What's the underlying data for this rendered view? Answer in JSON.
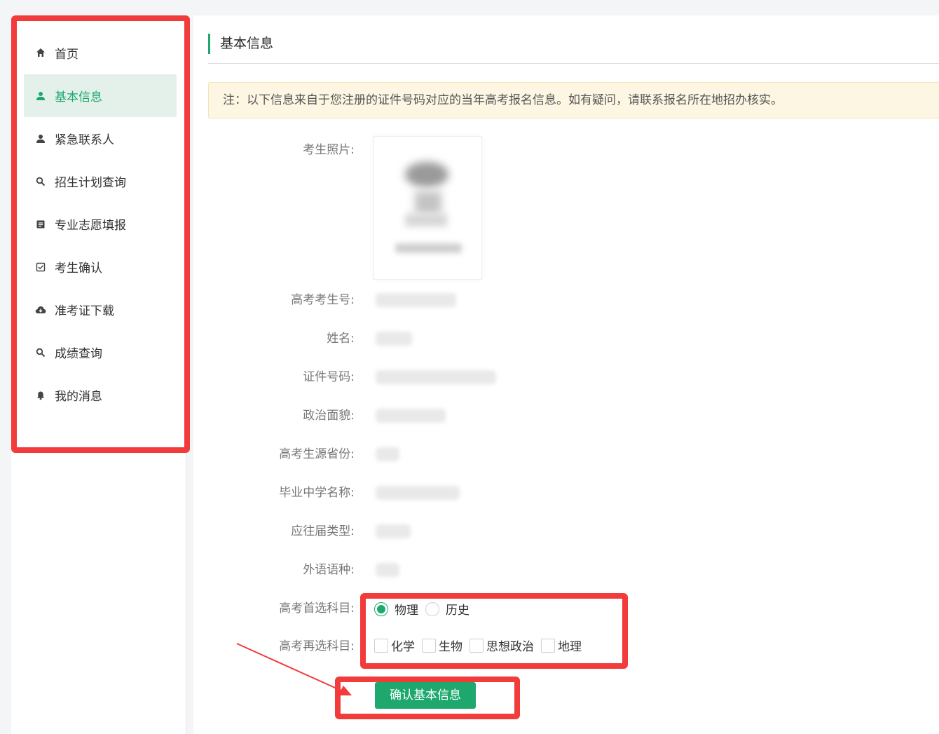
{
  "sidebar": {
    "items": [
      {
        "label": "首页",
        "icon": "home-icon"
      },
      {
        "label": "基本信息",
        "icon": "person-icon",
        "active": true
      },
      {
        "label": "紧急联系人",
        "icon": "person-icon"
      },
      {
        "label": "招生计划查询",
        "icon": "search-icon"
      },
      {
        "label": "专业志愿填报",
        "icon": "document-icon"
      },
      {
        "label": "考生确认",
        "icon": "checkbox-icon"
      },
      {
        "label": "准考证下载",
        "icon": "cloud-download-icon"
      },
      {
        "label": "成绩查询",
        "icon": "search-icon"
      },
      {
        "label": "我的消息",
        "icon": "bell-icon"
      }
    ]
  },
  "main": {
    "title": "基本信息",
    "notice": "注：以下信息来自于您注册的证件号码对应的当年高考报名信息。如有疑问，请联系报名所在地招办核实。",
    "photo_label": "考生照片:",
    "fields": [
      {
        "label": "高考考生号:"
      },
      {
        "label": "姓名:"
      },
      {
        "label": "证件号码:"
      },
      {
        "label": "政治面貌:"
      },
      {
        "label": "高考生源省份:"
      },
      {
        "label": "毕业中学名称:"
      },
      {
        "label": "应往届类型:"
      },
      {
        "label": "外语语种:"
      }
    ],
    "first_subject": {
      "label": "高考首选科目:",
      "options": [
        "物理",
        "历史"
      ],
      "selected": "物理"
    },
    "second_subject": {
      "label": "高考再选科目:",
      "options": [
        "化学",
        "生物",
        "思想政治",
        "地理"
      ]
    },
    "confirm_button": "确认基本信息"
  },
  "colors": {
    "accent": "#1ea86e",
    "annotation": "#f23c3c",
    "notice_bg": "#fdf6e3"
  }
}
